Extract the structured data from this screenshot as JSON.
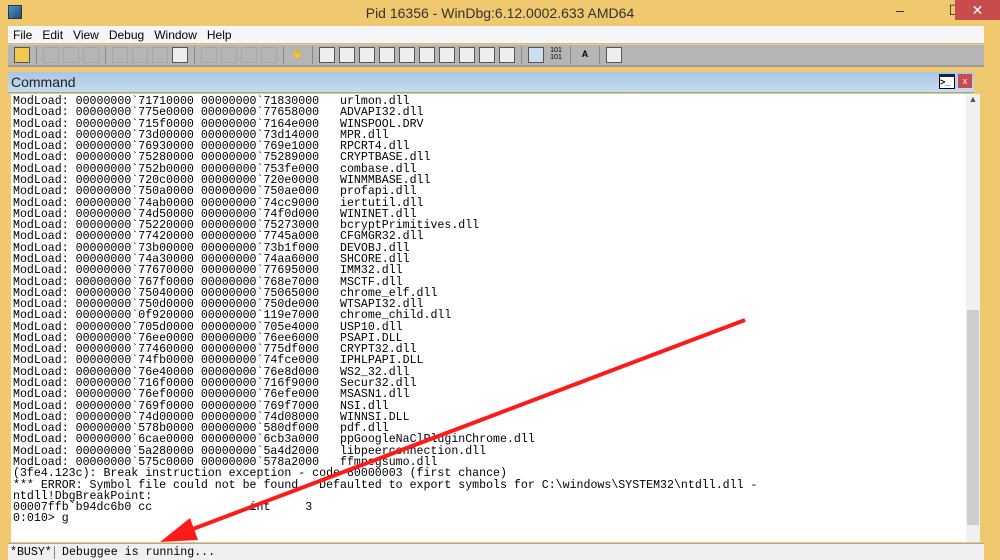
{
  "window": {
    "title": "Pid 16356 - WinDbg:6.12.0002.633 AMD64",
    "minimize": "–",
    "maximize": "☐",
    "close": "✕"
  },
  "menu": [
    "File",
    "Edit",
    "View",
    "Debug",
    "Window",
    "Help"
  ],
  "command_window": {
    "title": "Command",
    "close": "x",
    "icon": ">_"
  },
  "output_lines": [
    "ModLoad: 00000000`71710000 00000000`71830000   urlmon.dll",
    "ModLoad: 00000000`775e0000 00000000`77658000   ADVAPI32.dll",
    "ModLoad: 00000000`715f0000 00000000`7164e000   WINSPOOL.DRV",
    "ModLoad: 00000000`73d00000 00000000`73d14000   MPR.dll",
    "ModLoad: 00000000`76930000 00000000`769e1000   RPCRT4.dll",
    "ModLoad: 00000000`75280000 00000000`75289000   CRYPTBASE.dll",
    "ModLoad: 00000000`752b0000 00000000`753fe000   combase.dll",
    "ModLoad: 00000000`720c0000 00000000`720e0000   WINMMBASE.dll",
    "ModLoad: 00000000`750a0000 00000000`750ae000   profapi.dll",
    "ModLoad: 00000000`74ab0000 00000000`74cc9000   iertutil.dll",
    "ModLoad: 00000000`74d50000 00000000`74f0d000   WININET.dll",
    "ModLoad: 00000000`75220000 00000000`75273000   bcryptPrimitives.dll",
    "ModLoad: 00000000`77420000 00000000`7745a000   CFGMGR32.dll",
    "ModLoad: 00000000`73b00000 00000000`73b1f000   DEVOBJ.dll",
    "ModLoad: 00000000`74a30000 00000000`74aa6000   SHCORE.dll",
    "ModLoad: 00000000`77670000 00000000`77695000   IMM32.dll",
    "ModLoad: 00000000`767f0000 00000000`768e7000   MSCTF.dll",
    "ModLoad: 00000000`75040000 00000000`75065000   chrome_elf.dll",
    "ModLoad: 00000000`750d0000 00000000`750de000   WTSAPI32.dll",
    "ModLoad: 00000000`0f920000 00000000`119e7000   chrome_child.dll",
    "ModLoad: 00000000`705d0000 00000000`705e4000   USP10.dll",
    "ModLoad: 00000000`76ee0000 00000000`76ee6000   PSAPI.DLL",
    "ModLoad: 00000000`77460000 00000000`775df000   CRYPT32.dll",
    "ModLoad: 00000000`74fb0000 00000000`74fce000   IPHLPAPI.DLL",
    "ModLoad: 00000000`76e40000 00000000`76e8d000   WS2_32.dll",
    "ModLoad: 00000000`716f0000 00000000`716f9000   Secur32.dll",
    "ModLoad: 00000000`76ef0000 00000000`76efe000   MSASN1.dll",
    "ModLoad: 00000000`769f0000 00000000`769f7000   NSI.dll",
    "ModLoad: 00000000`74d00000 00000000`74d08000   WINNSI.DLL",
    "ModLoad: 00000000`578b0000 00000000`580df000   pdf.dll",
    "ModLoad: 00000000`6cae0000 00000000`6cb3a000   ppGoogleNaClPluginChrome.dll",
    "ModLoad: 00000000`5a280000 00000000`5a4d2000   libpeerconnection.dll",
    "ModLoad: 00000000`575c0000 00000000`578a2000   ffmpegsumo.dll",
    "(3fe4.123c): Break instruction exception - code 80000003 (first chance)",
    "*** ERROR: Symbol file could not be found.  Defaulted to export symbols for C:\\windows\\SYSTEM32\\ntdll.dll - ",
    "ntdll!DbgBreakPoint:",
    "00007ffb`b94dc6b0 cc              int     3",
    "0:010> g"
  ],
  "status": {
    "busy": "*BUSY*",
    "text": "Debuggee is running..."
  },
  "colors": {
    "frame": "#f0c86e",
    "close": "#c84c4c",
    "arrow": "#ff1a1a"
  }
}
